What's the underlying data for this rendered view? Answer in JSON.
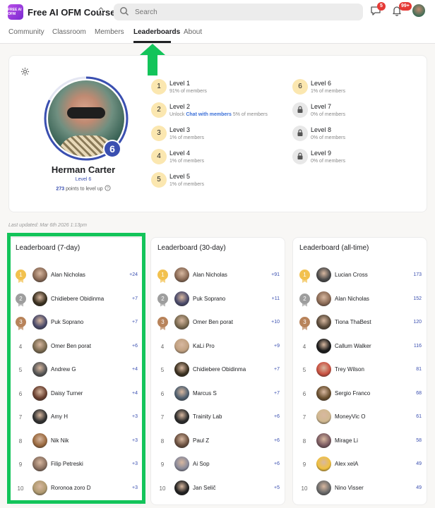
{
  "header": {
    "logo_text": "FREE AI OFM",
    "course_name": "Free AI OFM Course",
    "search_placeholder": "Search",
    "chat_badge": "5",
    "notif_badge": "99+"
  },
  "tabs": [
    "Community",
    "Classroom",
    "Members",
    "Leaderboards",
    "About"
  ],
  "active_tab": "Leaderboards",
  "profile": {
    "name": "Herman Carter",
    "level_label": "Level 6",
    "level_number": "6",
    "points": "273",
    "points_suffix": "points to level up"
  },
  "levels": [
    {
      "num": "1",
      "title": "Level 1",
      "sub": "91% of members",
      "locked": false
    },
    {
      "num": "2",
      "title": "Level 2",
      "sub_prefix": "Unlock ",
      "sub_link": "Chat with members",
      "sub": "5% of members",
      "locked": false
    },
    {
      "num": "3",
      "title": "Level 3",
      "sub": "1% of members",
      "locked": false
    },
    {
      "num": "4",
      "title": "Level 4",
      "sub": "1% of members",
      "locked": false
    },
    {
      "num": "5",
      "title": "Level 5",
      "sub": "1% of members",
      "locked": false
    },
    {
      "num": "6",
      "title": "Level 6",
      "sub": "1% of members",
      "locked": false
    },
    {
      "num": "",
      "title": "Level 7",
      "sub": "0% of members",
      "locked": true
    },
    {
      "num": "",
      "title": "Level 8",
      "sub": "0% of members",
      "locked": true
    },
    {
      "num": "",
      "title": "Level 9",
      "sub": "0% of members",
      "locked": true
    }
  ],
  "last_updated": "Last updated: Mar 6th 2026 1:13pm",
  "boards": [
    {
      "title": "Leaderboard (7-day)",
      "rows": [
        {
          "rank": "1",
          "name": "Alan Nicholas",
          "points": "+24",
          "color": "#8a6a55"
        },
        {
          "rank": "2",
          "name": "Chidiebere Obidinma",
          "points": "+7",
          "color": "#3a3020"
        },
        {
          "rank": "3",
          "name": "Puk Soprano",
          "points": "+7",
          "color": "#4a4a6a"
        },
        {
          "rank": "4",
          "name": "Omer Ben porat",
          "points": "+6",
          "color": "#7a6a50"
        },
        {
          "rank": "5",
          "name": "Andrew G",
          "points": "+4",
          "color": "#555555"
        },
        {
          "rank": "6",
          "name": "Daisy Turner",
          "points": "+4",
          "color": "#6a4030"
        },
        {
          "rank": "7",
          "name": "Amy H",
          "points": "+3",
          "color": "#303030"
        },
        {
          "rank": "8",
          "name": "Nik Nik",
          "points": "+3",
          "color": "#9a6a40"
        },
        {
          "rank": "9",
          "name": "Filip Petreski",
          "points": "+3",
          "color": "#8a7060"
        },
        {
          "rank": "10",
          "name": "Roronoa zoro D",
          "points": "+3",
          "color": "#b09a70"
        }
      ]
    },
    {
      "title": "Leaderboard (30-day)",
      "rows": [
        {
          "rank": "1",
          "name": "Alan Nicholas",
          "points": "+91",
          "color": "#8a6a55"
        },
        {
          "rank": "2",
          "name": "Puk Soprano",
          "points": "+11",
          "color": "#4a4a6a"
        },
        {
          "rank": "3",
          "name": "Omer Ben porat",
          "points": "+10",
          "color": "#7a6a50"
        },
        {
          "rank": "4",
          "name": "KaLi Pro",
          "points": "+9",
          "color": "#c0a080"
        },
        {
          "rank": "5",
          "name": "Chidiebere Obidinma",
          "points": "+7",
          "color": "#3a3020"
        },
        {
          "rank": "6",
          "name": "Marcus S",
          "points": "+7",
          "color": "#506070"
        },
        {
          "rank": "7",
          "name": "Trainity Lab",
          "points": "+6",
          "color": "#2a2a2a"
        },
        {
          "rank": "8",
          "name": "Paul Z",
          "points": "+6",
          "color": "#6a5040"
        },
        {
          "rank": "9",
          "name": "Ai Sop",
          "points": "+6",
          "color": "#8a8a9a"
        },
        {
          "rank": "10",
          "name": "Jan Selič",
          "points": "+5",
          "color": "#202020"
        }
      ]
    },
    {
      "title": "Leaderboard (all-time)",
      "rows": [
        {
          "rank": "1",
          "name": "Lucian Cross",
          "points": "173",
          "color": "#4a4a4a"
        },
        {
          "rank": "2",
          "name": "Alan Nicholas",
          "points": "152",
          "color": "#8a6a55"
        },
        {
          "rank": "3",
          "name": "Tiona ThaBest",
          "points": "120",
          "color": "#5a4a3a"
        },
        {
          "rank": "4",
          "name": "Callum Walker",
          "points": "116",
          "color": "#1a1a1a"
        },
        {
          "rank": "5",
          "name": "Trey Wilson",
          "points": "81",
          "color": "#c85040"
        },
        {
          "rank": "6",
          "name": "Sergio Franco",
          "points": "68",
          "color": "#6a5030"
        },
        {
          "rank": "7",
          "name": "MoneyVic O",
          "points": "61",
          "color": "#d0b890"
        },
        {
          "rank": "8",
          "name": "Mirage Li",
          "points": "58",
          "color": "#7a5a60"
        },
        {
          "rank": "9",
          "name": "Alex xelA",
          "points": "49",
          "color": "#f0c040"
        },
        {
          "rank": "10",
          "name": "Nino Visser",
          "points": "49",
          "color": "#6a6a6a"
        }
      ]
    }
  ]
}
